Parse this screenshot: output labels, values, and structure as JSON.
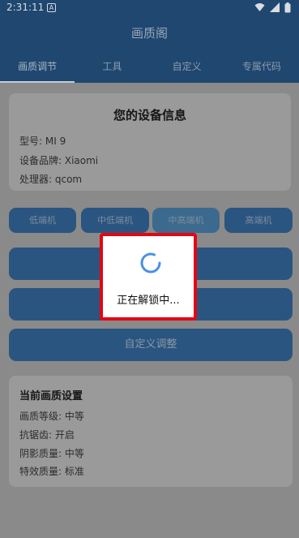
{
  "status": {
    "time": "2:31:11",
    "badge": "A"
  },
  "appbar": {
    "title": "画质阁"
  },
  "tabs": [
    {
      "label": "画质调节"
    },
    {
      "label": "工具"
    },
    {
      "label": "自定义"
    },
    {
      "label": "专属代码"
    }
  ],
  "device": {
    "title": "您的设备信息",
    "model": "型号: MI 9",
    "brand": "设备品牌: Xiaomi",
    "processor": "处理器: qcom"
  },
  "tiers": [
    {
      "label": "低端机"
    },
    {
      "label": "中低端机"
    },
    {
      "label": "中高端机"
    },
    {
      "label": "高端机"
    }
  ],
  "buttons": {
    "custom": "自定义调整"
  },
  "current": {
    "title": "当前画质设置",
    "quality": "画质等级: 中等",
    "aa": "抗锯齿: 开启",
    "shadow": "阴影质量: 中等",
    "effects": "特效质量: 标准"
  },
  "dialog": {
    "message": "正在解锁中..."
  },
  "colors": {
    "accent": "#4a90e2",
    "highlight": "#e30613"
  }
}
